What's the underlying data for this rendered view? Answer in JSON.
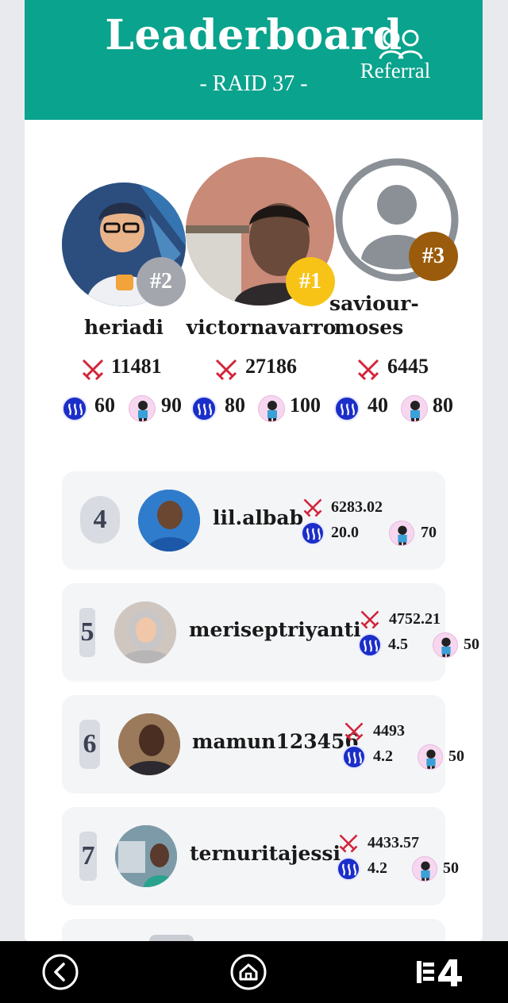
{
  "header": {
    "title": "Leaderboard",
    "subtitle": "- RAID 37 -",
    "referral_label": "Referral"
  },
  "podium": [
    {
      "rank_badge": "#2",
      "name": "heriadi",
      "score": "11481",
      "steem": "60",
      "char": "90",
      "badge_color": "#a3a6ad"
    },
    {
      "rank_badge": "#1",
      "name": "victornavarro",
      "score": "27186",
      "steem": "80",
      "char": "100",
      "badge_color": "#f7c316"
    },
    {
      "rank_badge": "#3",
      "name_line1": "saviour-",
      "name_line2": "moses",
      "score": "6445",
      "steem": "40",
      "char": "80",
      "badge_color": "#9a5b0c"
    }
  ],
  "rows": [
    {
      "rank": "4",
      "name": "lil.albab",
      "score": "6283.02",
      "steem": "20.0",
      "char": "70"
    },
    {
      "rank": "5",
      "name": "meriseptriyanti",
      "score": "4752.21",
      "steem": "4.5",
      "char": "50"
    },
    {
      "rank": "6",
      "name": "mamun123456",
      "score": "4493",
      "steem": "4.2",
      "char": "50"
    },
    {
      "rank": "7",
      "name": "ternuritajessi",
      "score": "4433.57",
      "steem": "4.2",
      "char": "50"
    }
  ],
  "icons": {
    "score": "crossed-swords-icon",
    "steem": "steem-icon",
    "char": "character-icon",
    "referral": "users-icon",
    "back": "back-arrow-icon",
    "home": "home-icon",
    "nav_right": "menu-icon"
  },
  "colors": {
    "header": "#0aa38d",
    "swords": "#d2253a",
    "steem": "#1b2ec9"
  }
}
